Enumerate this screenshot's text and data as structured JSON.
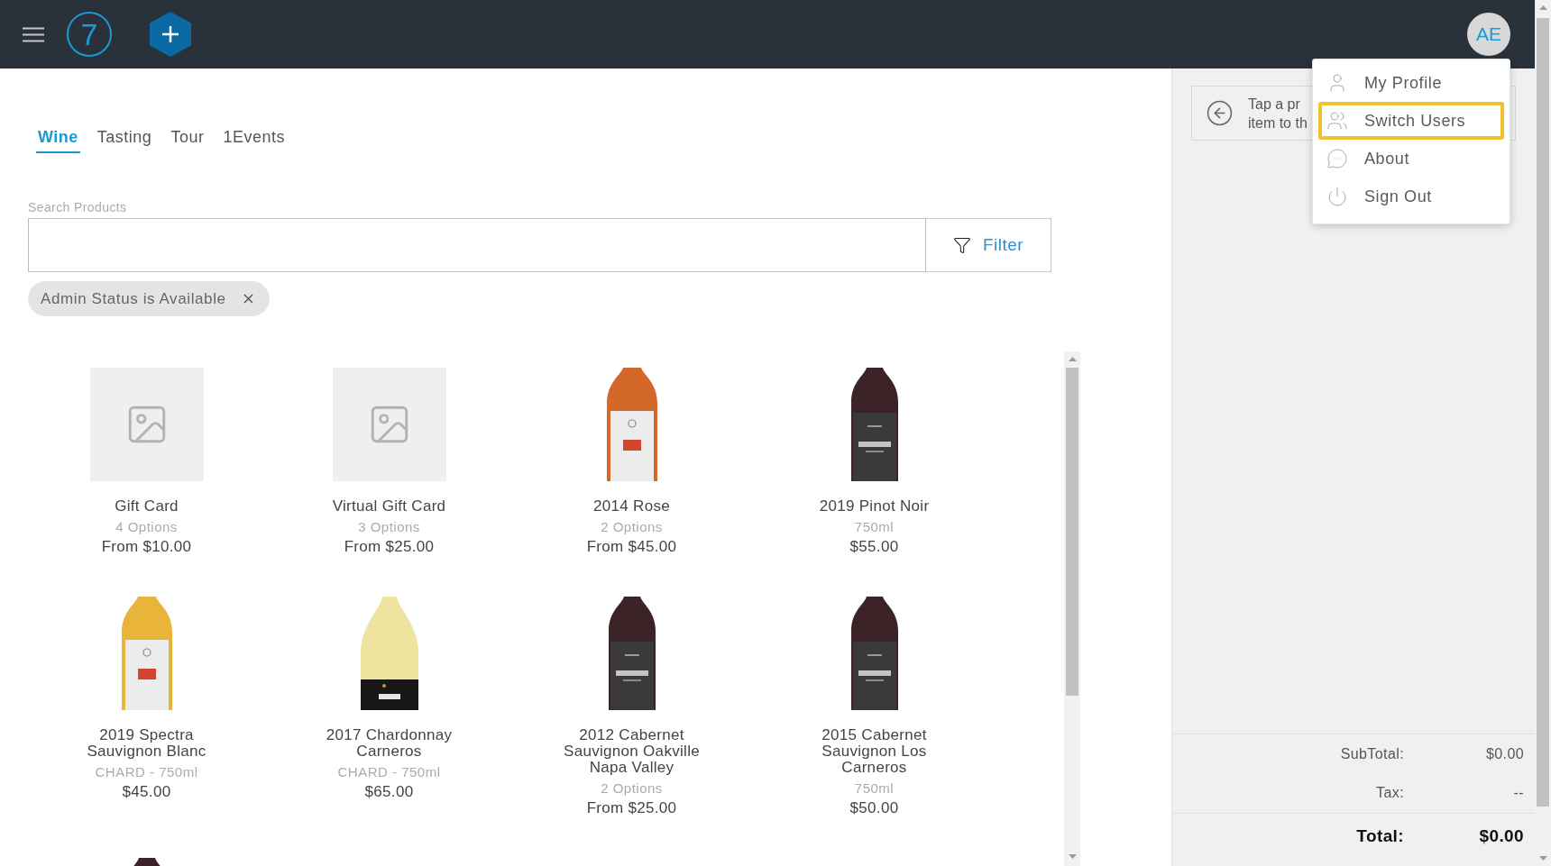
{
  "top_bar": {
    "logo": "7",
    "avatar": "AE"
  },
  "tabs": [
    {
      "label": "Wine",
      "selected": true
    },
    {
      "label": "Tasting",
      "selected": false
    },
    {
      "label": "Tour",
      "selected": false
    },
    {
      "label": "1Events",
      "selected": false
    }
  ],
  "search": {
    "label": "Search Products",
    "filter_button": "Filter"
  },
  "filter_chips": [
    {
      "label": "Admin Status is Available"
    }
  ],
  "products": [
    {
      "name": "Gift Card",
      "subtitle": "4 Options",
      "price": "From $10.00",
      "image": {
        "kind": "placeholder"
      }
    },
    {
      "name": "Virtual Gift Card",
      "subtitle": "3 Options",
      "price": "From $25.00",
      "image": {
        "kind": "placeholder"
      }
    },
    {
      "name": "2014 Rose",
      "subtitle": "2 Options",
      "price": "From $45.00",
      "image": {
        "kind": "label",
        "color": "#d4682a"
      }
    },
    {
      "name": "2019 Pinot Noir",
      "subtitle": "750ml",
      "price": "$55.00",
      "image": {
        "kind": "dark",
        "color": "#3b2328"
      }
    },
    {
      "name": "2019 Spectra Sauvignon Blanc",
      "subtitle": "CHARD - 750ml",
      "price": "$45.00",
      "image": {
        "kind": "label",
        "color": "#e8b53a"
      }
    },
    {
      "name": "2017 Chardonnay Carneros",
      "subtitle": "CHARD - 750ml",
      "price": "$65.00",
      "image": {
        "kind": "band",
        "color": "#efe3a0"
      }
    },
    {
      "name": "2012 Cabernet Sauvignon Oakville Napa Valley",
      "subtitle": "2 Options",
      "price": "From $25.00",
      "image": {
        "kind": "dark",
        "color": "#3b2328"
      }
    },
    {
      "name": "2015 Cabernet Sauvignon Los Carneros",
      "subtitle": "750ml",
      "price": "$50.00",
      "image": {
        "kind": "dark",
        "color": "#3b2328"
      }
    },
    {
      "image": {
        "kind": "dark",
        "color": "#3b2328"
      }
    }
  ],
  "cart": {
    "hint": [
      "Tap a pr",
      "item to th"
    ],
    "subtotal_label": "SubTotal:",
    "subtotal": "$0.00",
    "tax_label": "Tax:",
    "tax": "--",
    "total_label": "Total:",
    "total": "$0.00"
  },
  "user_menu": {
    "items": [
      {
        "label": "My Profile",
        "selected": false
      },
      {
        "label": "Switch Users",
        "selected": true
      },
      {
        "label": "About",
        "selected": false
      },
      {
        "label": "Sign Out",
        "selected": false
      }
    ]
  }
}
